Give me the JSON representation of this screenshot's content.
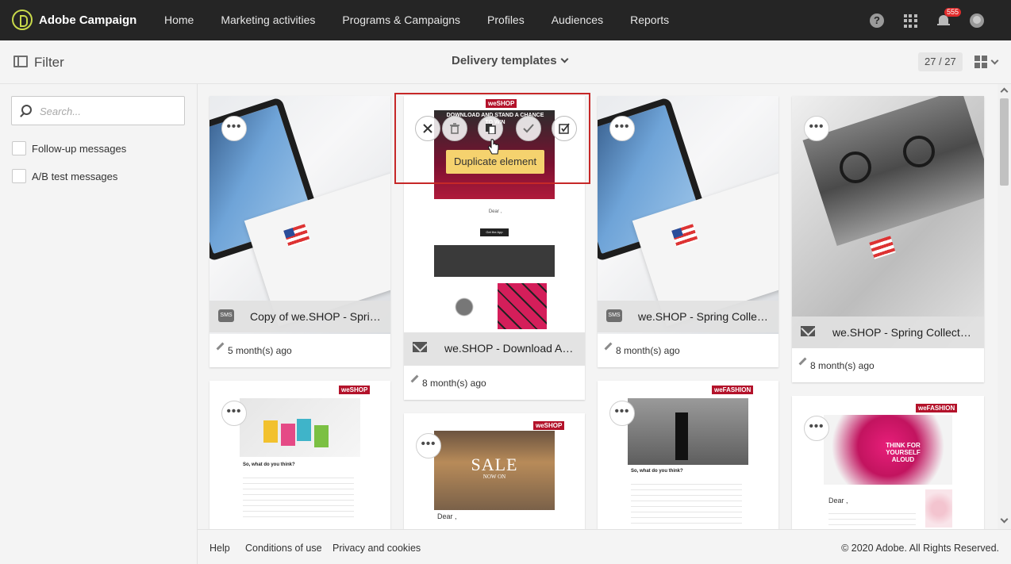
{
  "app": {
    "title": "Adobe Campaign"
  },
  "nav": {
    "items": [
      "Home",
      "Marketing activities",
      "Programs & Campaigns",
      "Profiles",
      "Audiences",
      "Reports"
    ]
  },
  "topbar": {
    "help": "?",
    "notifications_count": "555"
  },
  "subheader": {
    "filter_label": "Filter",
    "view_title": "Delivery templates",
    "count": "27 / 27"
  },
  "sidebar": {
    "search_placeholder": "Search...",
    "filters": [
      "Follow-up messages",
      "A/B test messages"
    ]
  },
  "cards": [
    {
      "title": "Copy of we.SHOP - Spring ...",
      "type_icon": "sms-icon",
      "modified": "5 month(s) ago"
    },
    {
      "title": "we.SHOP - Download App ...",
      "type_icon": "mail-icon",
      "modified": "8 month(s) ago"
    },
    {
      "title": "we.SHOP - Spring Collectio...",
      "type_icon": "sms-icon",
      "modified": "8 month(s) ago"
    },
    {
      "title": "we.SHOP - Spring Collection ...",
      "type_icon": "mail-icon",
      "modified": "8 month(s) ago"
    }
  ],
  "thumbnails": {
    "sms_label": "SMS",
    "download_heading": "DOWNLOAD AND STAND A CHANCE TO WIN",
    "download_dear": "Dear ,",
    "get_app": "Get the App",
    "shop_logo": "weSHOP",
    "fashion_logo": "weFASHION",
    "survey_heading": "So, what do you think?",
    "sale": "SALE",
    "sale_sub": "NOW ON",
    "dear": "Dear ,",
    "think": "THINK FOR YOURSELF ALOUD"
  },
  "selected_card": {
    "tooltip": "Duplicate element",
    "actions": [
      "close-icon",
      "delete-icon",
      "duplicate-icon",
      "check-icon",
      "select-icon"
    ]
  },
  "footer": {
    "links": [
      "Help",
      "Conditions of use",
      "Privacy and cookies"
    ],
    "copyright": "© 2020 Adobe. All Rights Reserved."
  },
  "colors": {
    "topbar": "#252525",
    "accent_logo": "#c8d94a",
    "badge": "#e02b2b",
    "selection": "#c62828",
    "tooltip": "#f5d26e"
  }
}
